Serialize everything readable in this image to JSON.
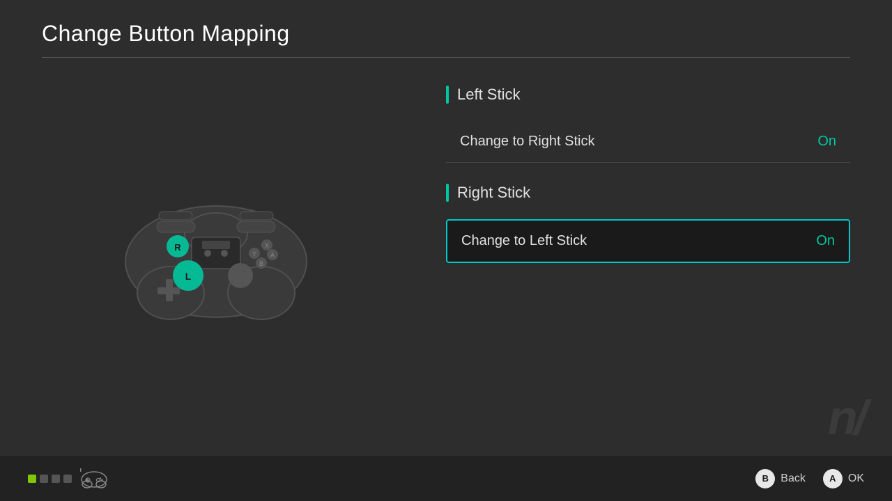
{
  "header": {
    "title": "Change Button Mapping"
  },
  "sections": [
    {
      "id": "left-stick",
      "title": "Left Stick",
      "options": [
        {
          "label": "Change to Right Stick",
          "value": "On",
          "selected": false
        }
      ]
    },
    {
      "id": "right-stick",
      "title": "Right Stick",
      "options": [
        {
          "label": "Change to Left Stick",
          "value": "On",
          "selected": true
        }
      ]
    }
  ],
  "footer": {
    "back_label": "Back",
    "ok_label": "OK",
    "back_btn": "B",
    "ok_btn": "A"
  },
  "controller": {
    "left_badge": "L",
    "right_badge": "R"
  }
}
